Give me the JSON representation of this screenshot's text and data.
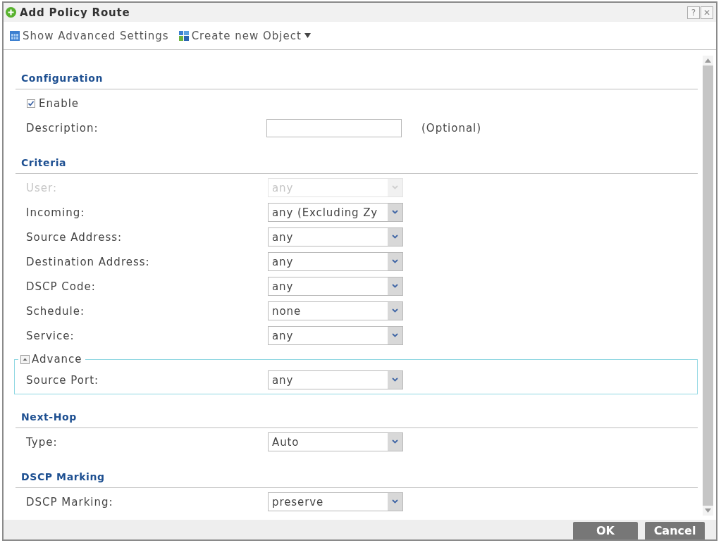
{
  "window": {
    "title": "Add Policy Route",
    "controls": [
      "?",
      "✕"
    ]
  },
  "toolbar": [
    {
      "kind": "button",
      "label": "Show Advanced Settings"
    },
    {
      "kind": "menu",
      "label": "Create new Object"
    }
  ],
  "sections": [
    {
      "title": "Configuration",
      "rows": [
        {
          "kind": "checkbox",
          "label": "Enable",
          "checked": true,
          "disabled": false
        },
        {
          "kind": "text",
          "label": "Description:",
          "note": "(Optional)",
          "disabled": false
        }
      ]
    },
    {
      "title": "Criteria",
      "rows": [
        {
          "kind": "select",
          "label": "User:",
          "value": "any",
          "disabled": true
        },
        {
          "kind": "select",
          "label": "Incoming:",
          "value": "any (Excluding Zy",
          "disabled": false
        },
        {
          "kind": "select",
          "label": "Source Address:",
          "value": "any",
          "disabled": false
        },
        {
          "kind": "select",
          "label": "Destination Address:",
          "value": "any",
          "disabled": false
        },
        {
          "kind": "select",
          "label": "DSCP Code:",
          "value": "any",
          "disabled": false
        },
        {
          "kind": "select",
          "label": "Schedule:",
          "value": "none",
          "disabled": false
        },
        {
          "kind": "select",
          "label": "Service:",
          "value": "any",
          "disabled": false
        },
        {
          "kind": "group",
          "legend": "Advance",
          "expanded": true,
          "disabled": false,
          "rows": [
            {
              "kind": "select",
              "label": "Source Port:",
              "value": "any",
              "disabled": false
            }
          ]
        }
      ]
    },
    {
      "title": "Next-Hop",
      "rows": [
        {
          "kind": "select",
          "label": "Type:",
          "value": "Auto",
          "disabled": false
        }
      ]
    },
    {
      "title": "DSCP Marking",
      "rows": [
        {
          "kind": "select",
          "label": "DSCP Marking:",
          "value": "preserve",
          "disabled": false
        }
      ]
    }
  ],
  "buttons": [
    "OK",
    "Cancel"
  ]
}
